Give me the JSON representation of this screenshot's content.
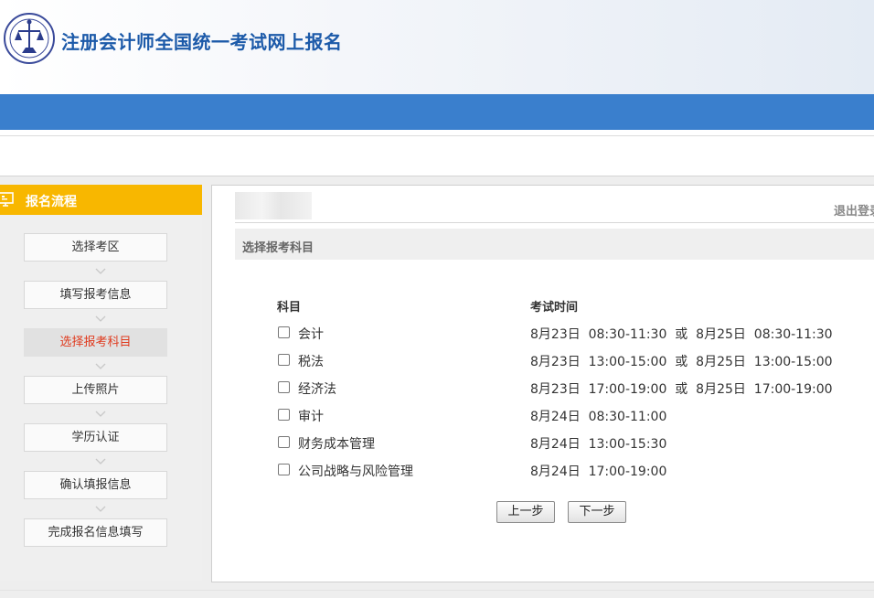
{
  "header": {
    "title": "注册会计师全国统一考试网上报名",
    "logo_icon": "cicpa-emblem-icon"
  },
  "sidebar": {
    "title": "报名流程",
    "title_icon": "monitor-icon",
    "active_color": "#e03a1e",
    "steps": [
      {
        "label": "选择考区",
        "active": false
      },
      {
        "label": "填写报考信息",
        "active": false
      },
      {
        "label": "选择报考科目",
        "active": true
      },
      {
        "label": "上传照片",
        "active": false
      },
      {
        "label": "学历认证",
        "active": false
      },
      {
        "label": "确认填报信息",
        "active": false
      },
      {
        "label": "完成报名信息填写",
        "active": false
      }
    ]
  },
  "main": {
    "logout": "退出登录",
    "section_title": "选择报考科目",
    "table": {
      "headers": [
        "科目",
        "考试时间"
      ],
      "rows": [
        {
          "subject": "会计",
          "time": "8月23日  08:30-11:30  或  8月25日  08:30-11:30",
          "checked": false
        },
        {
          "subject": "税法",
          "time": "8月23日  13:00-15:00  或  8月25日  13:00-15:00",
          "checked": false
        },
        {
          "subject": "经济法",
          "time": "8月23日  17:00-19:00  或  8月25日  17:00-19:00",
          "checked": false
        },
        {
          "subject": "审计",
          "time": "8月24日  08:30-11:00",
          "checked": false
        },
        {
          "subject": "财务成本管理",
          "time": "8月24日  13:00-15:30",
          "checked": false
        },
        {
          "subject": "公司战略与风险管理",
          "time": "8月24日  17:00-19:00",
          "checked": false
        }
      ]
    },
    "buttons": {
      "prev": "上一步",
      "next": "下一步"
    }
  },
  "colors": {
    "header_blue": "#3a7fcd",
    "sidebar_header": "#f8b700",
    "title_blue": "#1c5aa9"
  }
}
